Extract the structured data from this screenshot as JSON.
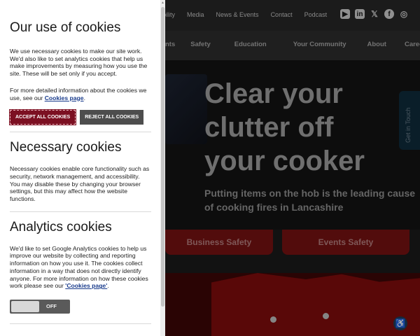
{
  "site": {
    "toplinks": [
      "bility",
      "Media",
      "News & Events",
      "Contact",
      "Podcast"
    ],
    "social_icons": [
      "youtube-icon",
      "linkedin-icon",
      "x-icon",
      "facebook-icon",
      "instagram-icon"
    ],
    "mainnav": [
      "nts",
      "Safety",
      "Education",
      "Your Community",
      "About",
      "Careers"
    ],
    "hero_title": "Clear your\nclutter off\nyour cooker",
    "hero_subtitle": "Putting items on the hob is the leading cause of cooking fires in Lancashire",
    "tab_business": "Business Safety",
    "tab_events": "Events Safety",
    "get_in_touch": "Get in Touch"
  },
  "cookies": {
    "title": "Our use of cookies",
    "intro": "We use necessary cookies to make our site work. We'd also like to set analytics cookies that help us make improvements by measuring how you use the site. These will be set only if you accept.",
    "more_prefix": "For more detailed information about the cookies we use, see our ",
    "more_link": "Cookies page",
    "more_suffix": ".",
    "accept_label": "ACCEPT ALL COOKIES",
    "reject_label": "REJECT ALL COOKIES",
    "necessary_title": "Necessary cookies",
    "necessary_text": "Necessary cookies enable core functionality such as security, network management, and accessibility. You may disable these by changing your browser settings, but this may affect how the website functions.",
    "analytics_title": "Analytics cookies",
    "analytics_text": "We'd like to set Google Analytics cookies to help us improve our website by collecting and reporting information on how you use it. The cookies collect information in a way that does not directly identify anyone. For more information on how these cookies work please see our ",
    "analytics_link": "'Cookies page'",
    "analytics_suffix": ".",
    "toggle_label": "OFF"
  }
}
